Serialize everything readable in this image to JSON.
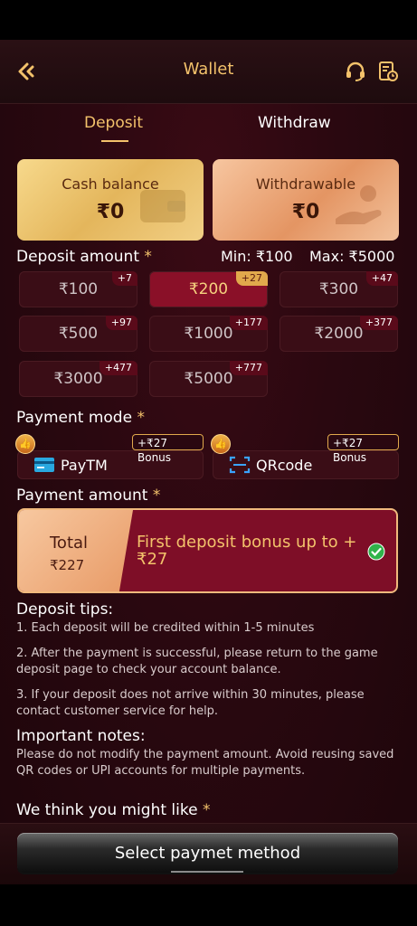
{
  "header": {
    "title": "Wallet"
  },
  "tabs": [
    {
      "label": "Deposit"
    },
    {
      "label": "Withdraw"
    }
  ],
  "balances": {
    "cash_label": "Cash balance",
    "cash_value": "₹0",
    "withdrawable_label": "Withdrawable",
    "withdrawable_value": "₹0"
  },
  "deposit_amount": {
    "label": "Deposit amount",
    "required_mark": "*",
    "min": "Min: ₹100",
    "max": "Max: ₹5000",
    "options": [
      {
        "value": "₹100",
        "bonus": "+7"
      },
      {
        "value": "₹200",
        "bonus": "+27"
      },
      {
        "value": "₹300",
        "bonus": "+47"
      },
      {
        "value": "₹500",
        "bonus": "+97"
      },
      {
        "value": "₹1000",
        "bonus": "+177"
      },
      {
        "value": "₹2000",
        "bonus": "+377"
      },
      {
        "value": "₹3000",
        "bonus": "+477"
      },
      {
        "value": "₹5000",
        "bonus": "+777"
      }
    ],
    "selected": "₹200"
  },
  "payment_mode": {
    "label": "Payment mode",
    "required_mark": "*",
    "methods": [
      {
        "name": "PayTM",
        "bonus": "+₹27 Bonus"
      },
      {
        "name": "QRcode",
        "bonus": "+₹27 Bonus"
      }
    ]
  },
  "payment_amount": {
    "label": "Payment amount",
    "required_mark": "*",
    "total_label": "Total",
    "total_value": "₹227",
    "bonus_text": "First deposit bonus up to +₹27"
  },
  "tips": {
    "title": "Deposit tips:",
    "items": [
      "1. Each deposit will be credited within 1-5 minutes",
      "2. After the payment is successful, please return to the game deposit page to check your account balance.",
      "3. If your deposit does not arrive within 30 minutes, please contact customer service for help."
    ]
  },
  "notes": {
    "title": "Important notes:",
    "text": "Please do not modify the payment amount. Avoid reusing saved QR codes or UPI accounts for multiple payments."
  },
  "suggest": {
    "label": "We think you might like",
    "required_mark": "*"
  },
  "footer": {
    "button_label": "Select paymet method"
  },
  "colors": {
    "accent": "#f3c26b",
    "selected_amount": "#8a1028",
    "background": "#2a0810"
  }
}
